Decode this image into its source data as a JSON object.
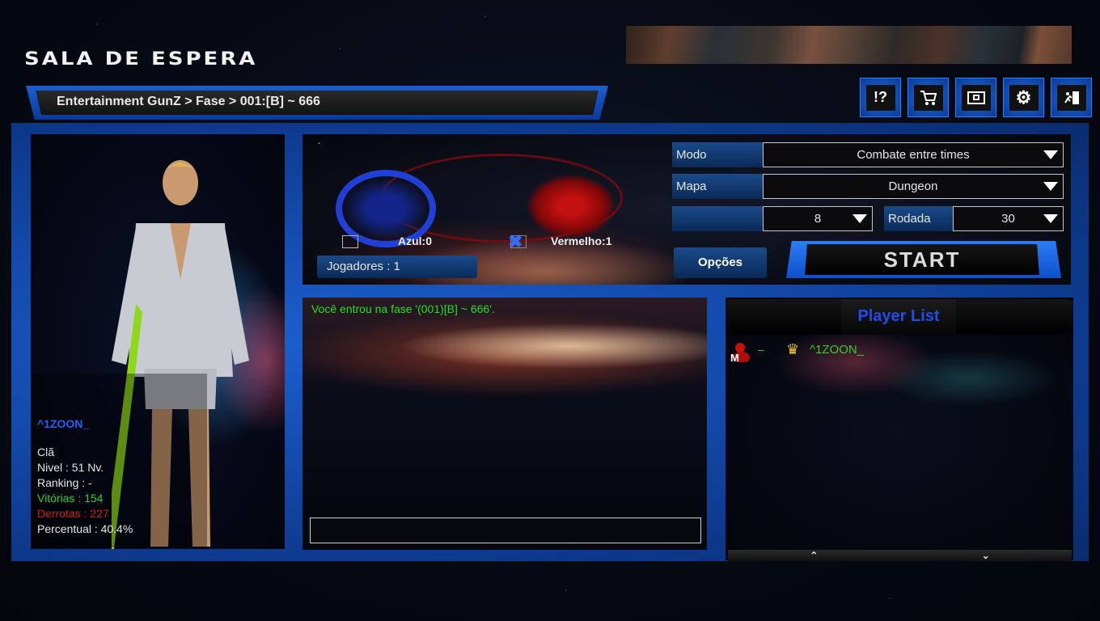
{
  "header": {
    "title": "SALA DE ESPERA",
    "breadcrumb": "Entertainment GunZ > Fase > 001:[B] ~ 666"
  },
  "toolbar": {
    "icons": [
      {
        "name": "help-icon",
        "glyph": "!?"
      },
      {
        "name": "shop-cart-icon",
        "glyph": "🛒"
      },
      {
        "name": "equipment-chest-icon",
        "glyph": "▣"
      },
      {
        "name": "settings-gear-icon",
        "glyph": "⚙"
      },
      {
        "name": "exit-door-icon",
        "glyph": "⇥"
      }
    ]
  },
  "character": {
    "name": "^1ZOON_",
    "clan": "Clã",
    "level": "Nivel : 51 Nv.",
    "ranking": "Ranking : -",
    "wins": "Vitórias : 154",
    "losses": "Derrotas : 227",
    "percentage": "Percentual : 40.4%",
    "colors": {
      "name": "#2060ff",
      "wins": "#2fd12f",
      "losses": "#d11b1b"
    }
  },
  "room": {
    "dash": "-",
    "team_blue_label": "Azul:0",
    "team_red_label": "Vermelho:1",
    "team_blue_selected": false,
    "team_red_selected": true,
    "players_label": "Jogadores : 1"
  },
  "settings": {
    "mode_label": "Modo",
    "mode_value": "Combate entre times",
    "map_label": "Mapa",
    "map_value": "Dungeon",
    "max_players_label": "",
    "max_players_value": "8",
    "rounds_label": "Rodada",
    "rounds_value": "30",
    "options_button": "Opções",
    "start_button": "START"
  },
  "chat": {
    "messages": [
      "Você entrou na fase '(001)[B] ~ 666'."
    ],
    "input_value": "",
    "message_color": "#22e022"
  },
  "player_list": {
    "title": "Player List",
    "players": [
      {
        "level_icon": "M",
        "clan": "–",
        "is_master": true,
        "name": "^1ZOON_"
      }
    ],
    "scroll_up": "⌃",
    "scroll_down": "⌄"
  }
}
